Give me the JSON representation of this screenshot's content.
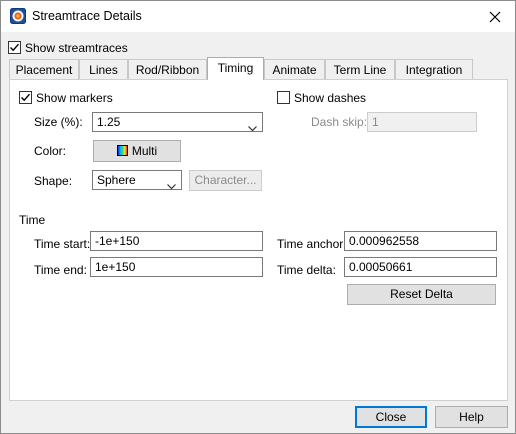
{
  "window": {
    "title": "Streamtrace Details"
  },
  "show_streamtraces": {
    "label": "Show streamtraces",
    "checked": true
  },
  "tabs": [
    {
      "label": "Placement"
    },
    {
      "label": "Lines"
    },
    {
      "label": "Rod/Ribbon"
    },
    {
      "label": "Timing",
      "active": true
    },
    {
      "label": "Animate"
    },
    {
      "label": "Term Line"
    },
    {
      "label": "Integration"
    }
  ],
  "timing": {
    "show_markers": {
      "label": "Show markers",
      "checked": true
    },
    "show_dashes": {
      "label": "Show dashes",
      "checked": false
    },
    "size": {
      "label": "Size (%):",
      "value": "1.25"
    },
    "dash_skip": {
      "label": "Dash skip:",
      "value": "1"
    },
    "color": {
      "label": "Color:",
      "button_label": "Multi"
    },
    "shape": {
      "label": "Shape:",
      "value": "Sphere",
      "character_button": "Character..."
    },
    "time_section": "Time",
    "time_start": {
      "label": "Time start:",
      "value": "-1e+150"
    },
    "time_end": {
      "label": "Time end:",
      "value": "1e+150"
    },
    "time_anchor": {
      "label": "Time anchor:",
      "value": "0.000962558"
    },
    "time_delta": {
      "label": "Time delta:",
      "value": "0.00050661"
    },
    "reset_delta": "Reset Delta"
  },
  "footer": {
    "close": "Close",
    "help": "Help"
  }
}
